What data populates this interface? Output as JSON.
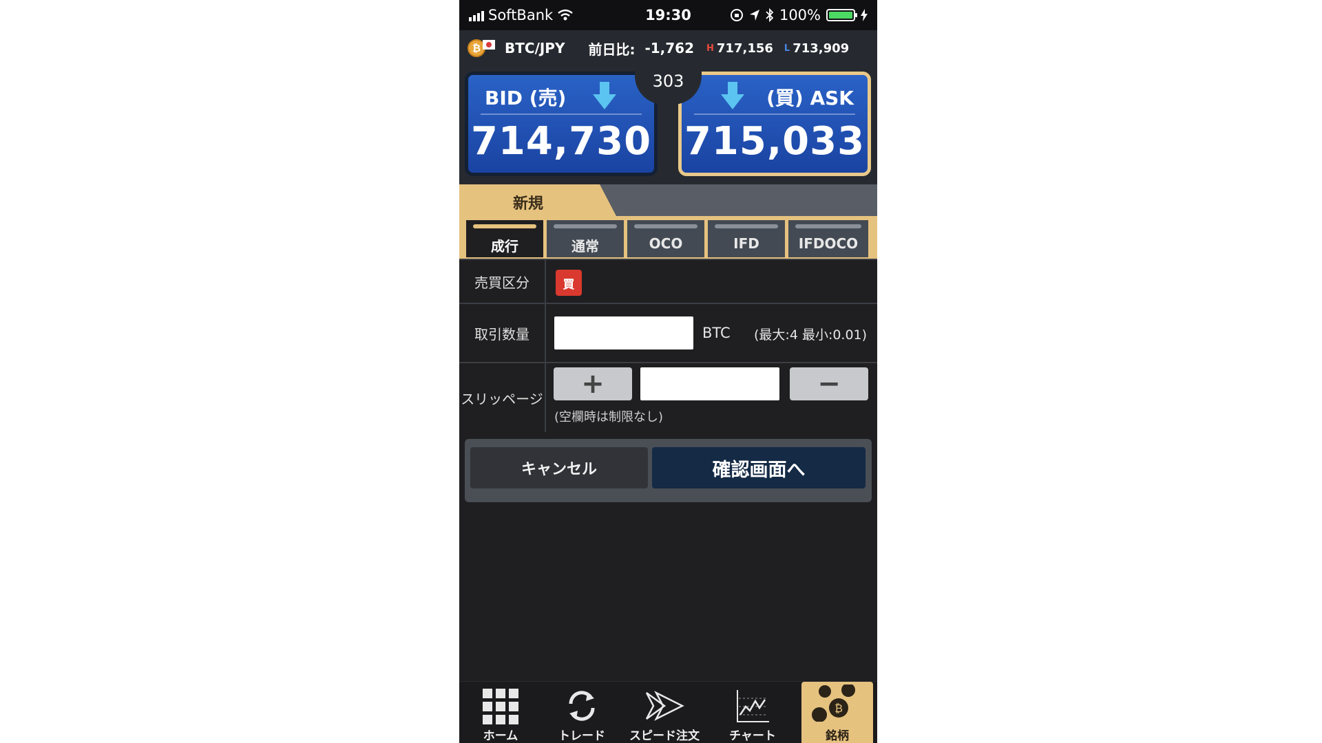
{
  "status_bar": {
    "carrier": "SoftBank",
    "time": "19:30",
    "battery": "100%",
    "battery_level": 1.0
  },
  "ticker": {
    "pair": "BTC/JPY",
    "change_label": "前日比:",
    "change_value": "-1,762",
    "high_marker": "H",
    "high_value": "717,156",
    "low_marker": "L",
    "low_value": "713,909"
  },
  "prices": {
    "bid_label": "BID (売)",
    "bid_value": "714,730",
    "ask_label": "(買) ASK",
    "ask_value": "715,033",
    "spread": "303"
  },
  "order_type": {
    "section_label": "新規",
    "tabs": [
      {
        "label": "成行",
        "active": true
      },
      {
        "label": "通常",
        "active": false
      },
      {
        "label": "OCO",
        "active": false
      },
      {
        "label": "IFD",
        "active": false
      },
      {
        "label": "IFDOCO",
        "active": false
      }
    ]
  },
  "form": {
    "side_label": "売買区分",
    "side_value": "買",
    "quantity_label": "取引数量",
    "quantity_value": "",
    "quantity_unit": "BTC",
    "quantity_limits": "(最大:4 最小:0.01)",
    "slippage_label": "スリッページ",
    "slippage_value": "",
    "slippage_plus": "+",
    "slippage_minus": "−",
    "slippage_hint": "(空欄時は制限なし)"
  },
  "actions": {
    "cancel": "キャンセル",
    "confirm": "確認画面へ"
  },
  "bottom_nav": [
    {
      "label": "ホーム",
      "icon": "grid-icon"
    },
    {
      "label": "トレード",
      "icon": "refresh-icon"
    },
    {
      "label": "スピード注文",
      "icon": "speed-arrow-icon"
    },
    {
      "label": "チャート",
      "icon": "chart-icon"
    },
    {
      "label": "銘柄",
      "icon": "coins-icon"
    }
  ],
  "colors": {
    "accent_gold": "#e6c27f",
    "bid_blue": "#1a43a2",
    "buy_red": "#d9392e",
    "confirm_navy": "#142a45"
  }
}
